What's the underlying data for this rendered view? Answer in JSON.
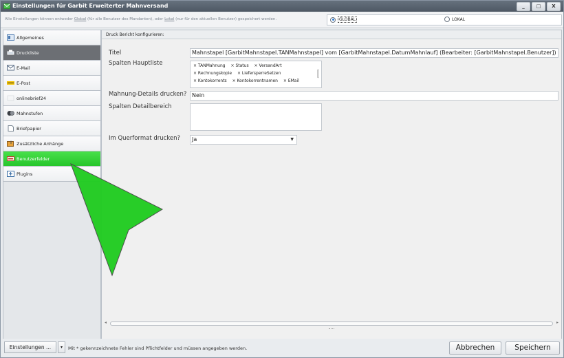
{
  "window": {
    "title": "Einstellungen für Garbit Erweiterter Mahnversand",
    "controls": [
      "_",
      "□",
      "X"
    ]
  },
  "scope": {
    "hint_prefix": "Alle Einstellungen können entweder ",
    "hint_global": "Global",
    "hint_middle": " (für alle Benutzer des Mandanten), oder ",
    "hint_lokal": "Lokal",
    "hint_suffix": " (nur für den aktuellen Benutzer) gespeichert werden.",
    "global_label": "GLOBAL",
    "lokal_label": "LOKAL",
    "selected": "GLOBAL"
  },
  "sidebar": {
    "items": [
      {
        "label": "Allgemeines",
        "icon": "general-icon"
      },
      {
        "label": "Druckliste",
        "icon": "print-list-icon",
        "selected": true
      },
      {
        "label": "E-Mail",
        "icon": "email-icon"
      },
      {
        "label": "E-Post",
        "icon": "epost-icon"
      },
      {
        "label": "onlinebrief24",
        "icon": "onlinebrief-icon"
      },
      {
        "label": "Mahnstufen",
        "icon": "dunning-levels-icon"
      },
      {
        "label": "Briefpapier",
        "icon": "letterhead-icon"
      },
      {
        "label": "Zusätzliche Anhänge",
        "icon": "attachments-icon"
      },
      {
        "label": "Benutzerfelder",
        "icon": "user-fields-icon",
        "highlighted": true
      },
      {
        "label": "Plugins",
        "icon": "plugins-icon"
      }
    ]
  },
  "main": {
    "group_title": "Druck Bericht konfigurieren:",
    "fields": {
      "titel_label": "Titel",
      "titel_value": "Mahnstapel [GarbitMahnstapel.TANMahnstapel] vom [GarbitMahnstapel.DatumMahnlauf] (Bearbeiter: [GarbitMahnstapel.Benutzer])",
      "spalten_label": "Spalten Hauptliste",
      "spalten_tokens": [
        [
          "× TANMahnung",
          "× Status",
          "× VersandArt"
        ],
        [
          "× Rechnungskopie",
          "× LiefersperreSetzen"
        ],
        [
          "× Kontokorrents",
          "× Kontokorrentnamen",
          "× EMail"
        ]
      ],
      "details_label": "Mahnung-Details drucken?",
      "details_value": "Nein",
      "detailbereich_label": "Spalten Detailbereich",
      "querformat_label": "Im Querformat drucken?",
      "querformat_value": "Ja"
    }
  },
  "footer": {
    "settings_button": "Einstellungen ...",
    "settings_dropdown": "▾",
    "note": "Mit * gekennzeichnete Fehler sind Pflichtfelder und müssen angegeben werden.",
    "cancel_button": "Abbrechen",
    "save_button": "Speichern"
  },
  "colors": {
    "titlebar": "#5a6470",
    "selected_nav": "#6c6f74",
    "highlight_nav": "#2fd032",
    "pointer": "#22cc22"
  }
}
